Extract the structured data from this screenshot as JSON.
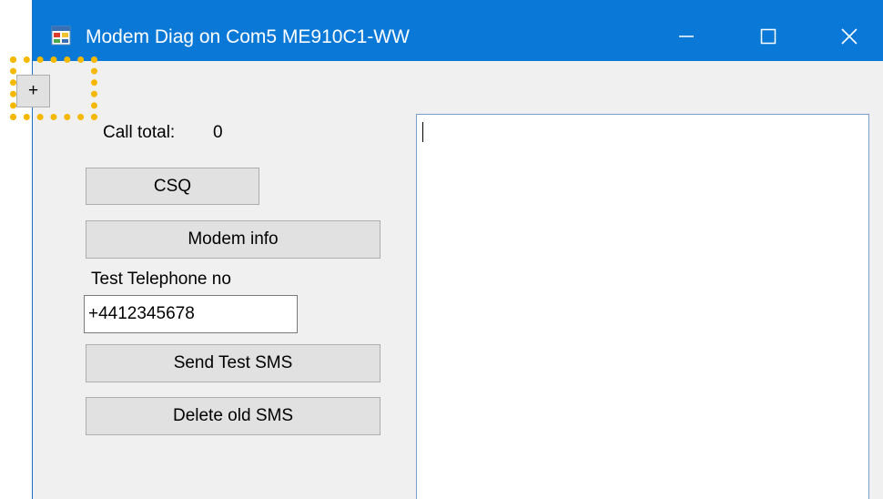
{
  "window": {
    "title": "Modem Diag on Com5 ME910C1-WW",
    "icon": "app-form-icon",
    "controls": {
      "minimize_icon": "minimize-icon",
      "maximize_icon": "maximize-icon",
      "close_icon": "close-icon"
    },
    "titlebar_color": "#0a78d7"
  },
  "form": {
    "plus_button_label": "+",
    "call_total_label": "Call total:",
    "call_total_value": "0",
    "csq_button_label": "CSQ",
    "modem_info_button_label": "Modem info",
    "test_phone_label": "Test Telephone no",
    "test_phone_value": "+4412345678",
    "send_sms_button_label": "Send Test SMS",
    "delete_sms_button_label": "Delete old SMS"
  },
  "log": {
    "text": ""
  },
  "annotation": {
    "highlight_color": "#f5b800"
  }
}
